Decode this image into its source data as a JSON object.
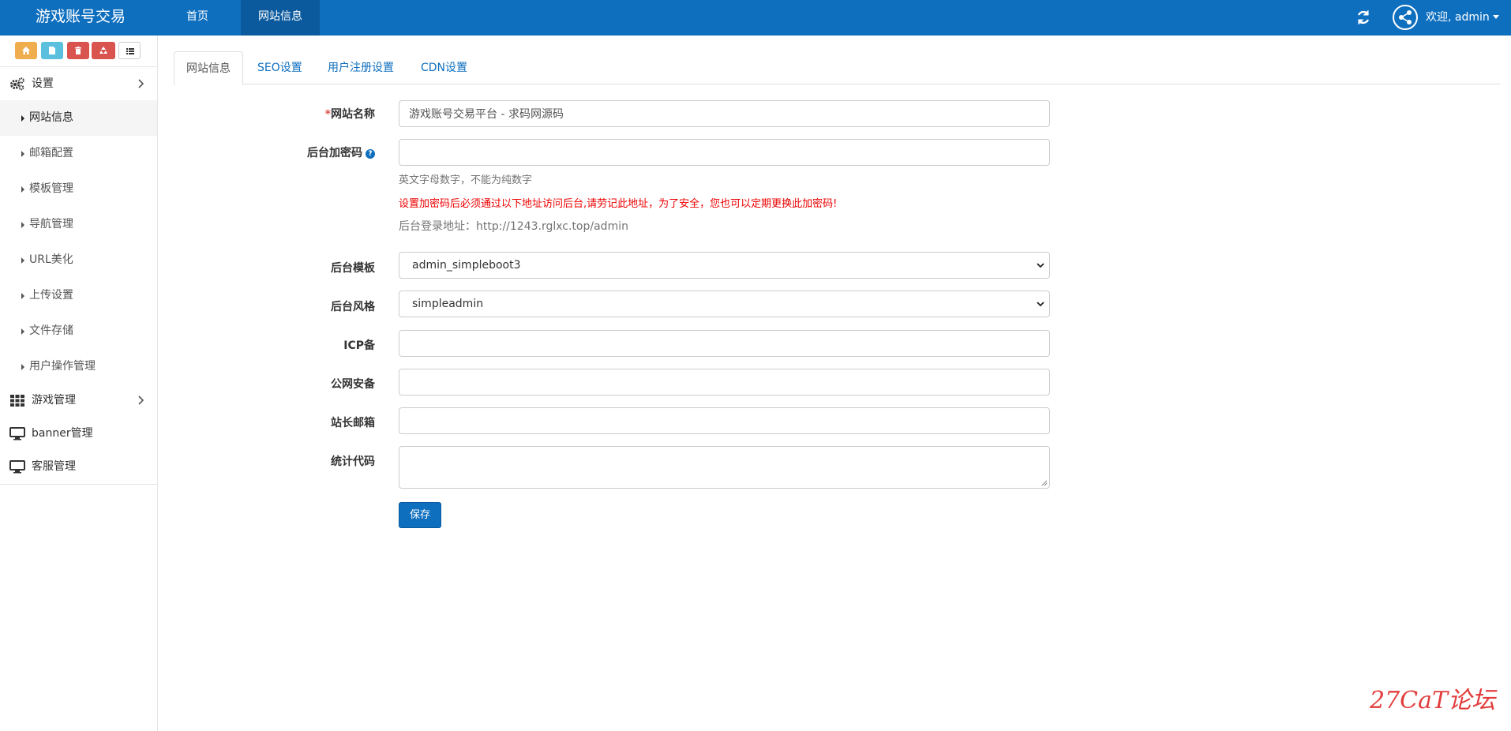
{
  "navbar": {
    "brand": "游戏账号交易",
    "items": [
      {
        "label": "首页"
      },
      {
        "label": "网站信息"
      }
    ],
    "welcome": "欢迎, admin"
  },
  "sidebar": {
    "groups": [
      {
        "label": "设置",
        "icon": "cogs-icon"
      },
      {
        "label": "游戏管理",
        "icon": "grid-icon"
      },
      {
        "label": "banner管理",
        "icon": "desktop-icon"
      },
      {
        "label": "客服管理",
        "icon": "desktop-icon"
      }
    ],
    "settings_items": [
      {
        "label": "网站信息"
      },
      {
        "label": "邮箱配置"
      },
      {
        "label": "模板管理"
      },
      {
        "label": "导航管理"
      },
      {
        "label": "URL美化"
      },
      {
        "label": "上传设置"
      },
      {
        "label": "文件存储"
      },
      {
        "label": "用户操作管理"
      }
    ]
  },
  "tabs": [
    {
      "label": "网站信息"
    },
    {
      "label": "SEO设置"
    },
    {
      "label": "用户注册设置"
    },
    {
      "label": "CDN设置"
    }
  ],
  "form": {
    "site_name": {
      "required_mark": "*",
      "label": "网站名称",
      "value": "游戏账号交易平台 - 求码网源码"
    },
    "admin_password": {
      "label": "后台加密码",
      "value": ""
    },
    "help_text": "英文字母数字，不能为纯数字",
    "warning_text": "设置加密码后必须通过以下地址访问后台,请劳记此地址，为了安全，您也可以定期更换此加密码!",
    "login_url": "后台登录地址：http://1243.rglxc.top/admin",
    "admin_theme": {
      "label": "后台模板",
      "value": "admin_simpleboot3"
    },
    "admin_style": {
      "label": "后台风格",
      "value": "simpleadmin"
    },
    "icp": {
      "label": "ICP备",
      "value": ""
    },
    "police": {
      "label": "公网安备",
      "value": ""
    },
    "webmaster_email": {
      "label": "站长邮箱",
      "value": ""
    },
    "stats_code": {
      "label": "统计代码",
      "value": ""
    },
    "save_label": "保存"
  },
  "watermark": "27CaT论坛",
  "colors": {
    "primary": "#0f6fbf",
    "danger": "#d9534f",
    "warning_text": "#e00000"
  }
}
